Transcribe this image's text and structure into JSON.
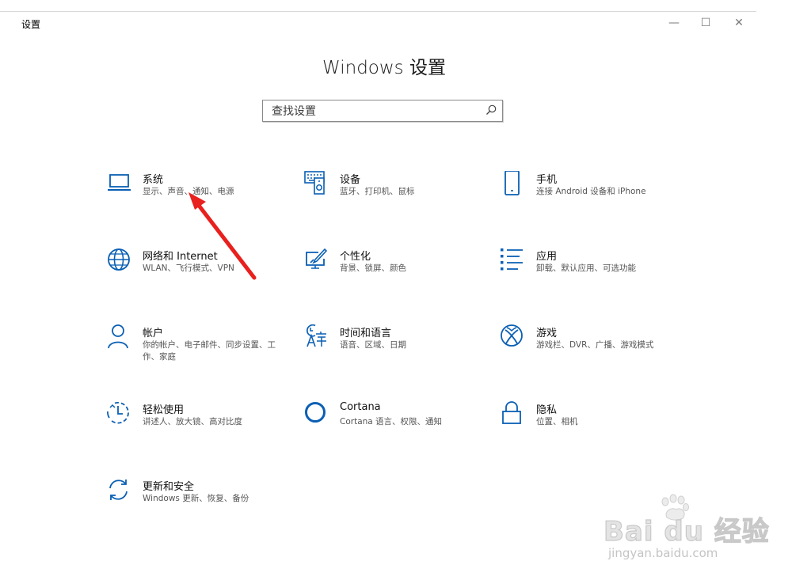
{
  "window": {
    "title": "设置",
    "minimize": "—",
    "maximize": "☐",
    "close": "✕"
  },
  "page_title": "Windows 设置",
  "search": {
    "placeholder": "查找设置",
    "value": ""
  },
  "tiles": [
    {
      "name": "system",
      "icon": "laptop-icon",
      "title": "系统",
      "desc": "显示、声音、通知、电源"
    },
    {
      "name": "devices",
      "icon": "keyboard-speaker-icon",
      "title": "设备",
      "desc": "蓝牙、打印机、鼠标"
    },
    {
      "name": "phone",
      "icon": "phone-icon",
      "title": "手机",
      "desc": "连接 Android 设备和 iPhone"
    },
    {
      "name": "network",
      "icon": "globe-icon",
      "title": "网络和 Internet",
      "desc": "WLAN、飞行模式、VPN"
    },
    {
      "name": "personalization",
      "icon": "paint-monitor-icon",
      "title": "个性化",
      "desc": "背景、锁屏、颜色"
    },
    {
      "name": "apps",
      "icon": "app-list-icon",
      "title": "应用",
      "desc": "卸载、默认应用、可选功能"
    },
    {
      "name": "accounts",
      "icon": "person-icon",
      "title": "帐户",
      "desc": "你的帐户、电子邮件、同步设置、工作、家庭"
    },
    {
      "name": "time-language",
      "icon": "clock-language-icon",
      "title": "时间和语言",
      "desc": "语音、区域、日期"
    },
    {
      "name": "gaming",
      "icon": "xbox-icon",
      "title": "游戏",
      "desc": "游戏栏、DVR、广播、游戏模式"
    },
    {
      "name": "ease-of-access",
      "icon": "ease-of-access-icon",
      "title": "轻松使用",
      "desc": "讲述人、放大镜、高对比度"
    },
    {
      "name": "cortana",
      "icon": "cortana-ring-icon",
      "title": "Cortana",
      "desc": "Cortana 语言、权限、通知"
    },
    {
      "name": "privacy",
      "icon": "lock-icon",
      "title": "隐私",
      "desc": "位置、相机"
    },
    {
      "name": "update-security",
      "icon": "sync-icon",
      "title": "更新和安全",
      "desc": "Windows 更新、恢复、备份"
    }
  ],
  "annotation": {
    "arrow_color": "#e8201e"
  },
  "watermark": {
    "brand": "Bai du 经验",
    "url": "jingyan.baidu.com"
  },
  "colors": {
    "accent": "#0a5fb4",
    "title_text": "#111111",
    "desc_text": "#555555"
  }
}
